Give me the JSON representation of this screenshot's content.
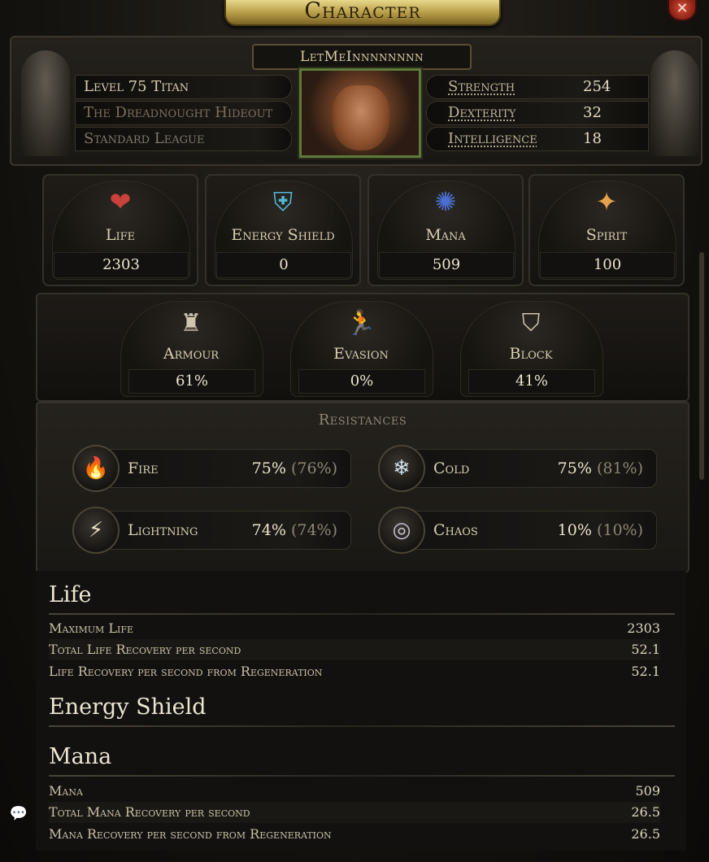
{
  "window": {
    "title": "Character",
    "close_glyph": "✕"
  },
  "character": {
    "name": "LetMeInnnnnnnn",
    "level_class": "Level 75 Titan",
    "location": "The Dreadnought Hideout",
    "league": "Standard League"
  },
  "attributes": [
    {
      "label": "Strength",
      "value": "254"
    },
    {
      "label": "Dexterity",
      "value": "32"
    },
    {
      "label": "Intelligence",
      "value": "18"
    }
  ],
  "defences_top": [
    {
      "label": "Life",
      "value": "2303",
      "icon": "heart-icon",
      "glyph": "❤",
      "color": "#c8413a"
    },
    {
      "label": "Energy Shield",
      "value": "0",
      "icon": "shield-icon",
      "glyph": "⛨",
      "color": "#4fb6d6"
    },
    {
      "label": "Mana",
      "value": "509",
      "icon": "mana-icon",
      "glyph": "✺",
      "color": "#4a6fd0"
    },
    {
      "label": "Spirit",
      "value": "100",
      "icon": "spirit-icon",
      "glyph": "✦",
      "color": "#e6a24a"
    }
  ],
  "defences_bottom": [
    {
      "label": "Armour",
      "value": "61%",
      "icon": "armour-icon",
      "glyph": "♜",
      "color": "#cfc6b0"
    },
    {
      "label": "Evasion",
      "value": "0%",
      "icon": "evasion-icon",
      "glyph": "🏃",
      "color": "#cfc6b0"
    },
    {
      "label": "Block",
      "value": "41%",
      "icon": "block-icon",
      "glyph": "⛉",
      "color": "#cfc6b0"
    }
  ],
  "resistances": {
    "title": "Resistances",
    "items": [
      {
        "label": "Fire",
        "value": "75%",
        "max": "(76%)",
        "icon": "fire-icon",
        "glyph": "🔥",
        "color": "#d9a08a"
      },
      {
        "label": "Cold",
        "value": "75%",
        "max": "(81%)",
        "icon": "cold-icon",
        "glyph": "❄",
        "color": "#cfe0ea"
      },
      {
        "label": "Lightning",
        "value": "74%",
        "max": "(74%)",
        "icon": "lightning-icon",
        "glyph": "⚡",
        "color": "#e9e2c4"
      },
      {
        "label": "Chaos",
        "value": "10%",
        "max": "(10%)",
        "icon": "chaos-icon",
        "glyph": "◎",
        "color": "#c9c0d0"
      }
    ]
  },
  "sections": {
    "life": {
      "title": "Life",
      "rows": [
        {
          "label": "Maximum Life",
          "value": "2303"
        },
        {
          "label": "Total Life Recovery per second",
          "value": "52.1"
        },
        {
          "label": "Life Recovery per second from Regeneration",
          "value": "52.1"
        }
      ]
    },
    "energy_shield": {
      "title": "Energy Shield"
    },
    "mana": {
      "title": "Mana",
      "rows": [
        {
          "label": "Mana",
          "value": "509"
        },
        {
          "label": "Total Mana Recovery per second",
          "value": "26.5"
        },
        {
          "label": "Mana Recovery per second from Regeneration",
          "value": "26.5"
        }
      ]
    }
  },
  "colors": {
    "gold_title": "#b59a45",
    "close_red": "#8a1f14",
    "text": "#c9c0a6"
  }
}
